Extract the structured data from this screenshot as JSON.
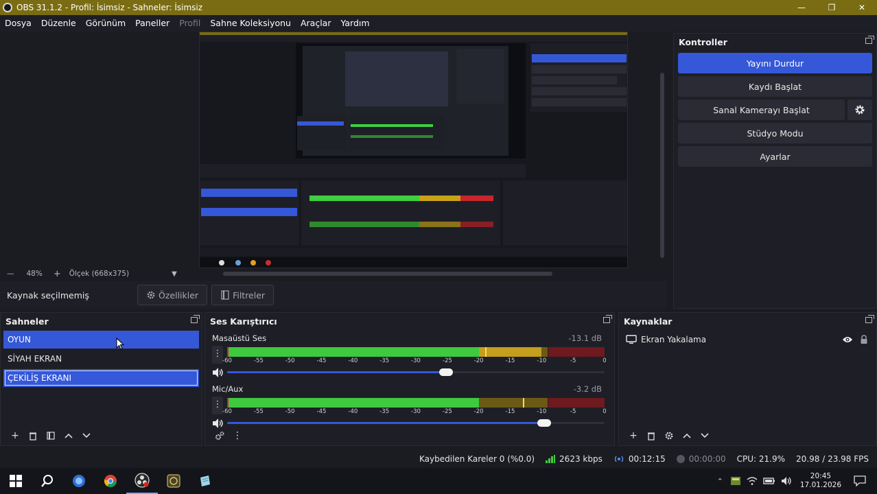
{
  "window": {
    "title": "OBS 31.1.2 - Profil: İsimsiz - Sahneler: İsimsiz"
  },
  "menu": {
    "items": [
      {
        "label": "Dosya",
        "enabled": true
      },
      {
        "label": "Düzenle",
        "enabled": true
      },
      {
        "label": "Görünüm",
        "enabled": true
      },
      {
        "label": "Paneller",
        "enabled": true
      },
      {
        "label": "Profil",
        "enabled": false
      },
      {
        "label": "Sahne Koleksiyonu",
        "enabled": true
      },
      {
        "label": "Araçlar",
        "enabled": true
      },
      {
        "label": "Yardım",
        "enabled": true
      }
    ]
  },
  "preview": {
    "zoom": "48%",
    "scale_label": "Ölçek (668x375)"
  },
  "source_bar": {
    "no_source": "Kaynak seçilmemiş",
    "properties": "Özellikler",
    "filters": "Filtreler"
  },
  "controls": {
    "title": "Kontroller",
    "stop_stream": "Yayını Durdur",
    "start_record": "Kaydı Başlat",
    "virtual_cam": "Sanal Kamerayı Başlat",
    "studio_mode": "Stüdyo Modu",
    "settings": "Ayarlar"
  },
  "scenes": {
    "title": "Sahneler",
    "items": [
      {
        "label": "OYUN",
        "state": "selected"
      },
      {
        "label": "SİYAH EKRAN",
        "state": "normal"
      },
      {
        "label": "ÇEKİLİŞ EKRANI",
        "state": "outlined"
      }
    ]
  },
  "mixer": {
    "title": "Ses Karıştırıcı",
    "scale": [
      "-60",
      "-55",
      "-50",
      "-45",
      "-40",
      "-35",
      "-30",
      "-25",
      "-20",
      "-15",
      "-10",
      "-5",
      "0"
    ],
    "channels": [
      {
        "name": "Masaüstü Ses",
        "db": "-13.1 dB",
        "level_db": -10,
        "peak_db": -19,
        "volume": 0.58
      },
      {
        "name": "Mic/Aux",
        "db": "-3.2 dB",
        "level_db": -20,
        "peak_db": -13,
        "volume": 0.84
      }
    ]
  },
  "sources": {
    "title": "Kaynaklar",
    "items": [
      {
        "label": "Ekran Yakalama",
        "visible": true,
        "locked": false
      }
    ]
  },
  "status": {
    "dropped": "Kaybedilen Kareler 0 (%0.0)",
    "bitrate": "2623 kbps",
    "stream_time": "00:12:15",
    "record_time": "00:00:00",
    "cpu": "CPU: 21.9%",
    "fps": "20.98 / 23.98 FPS"
  },
  "taskbar": {
    "time": "20:45",
    "date": "17.01.2026"
  },
  "colors": {
    "accent": "#3558d8",
    "titlebar": "#7a6c12",
    "meter_green": "#3fcf3f",
    "meter_yellow": "#c9a21c",
    "meter_red": "#c8262e"
  }
}
